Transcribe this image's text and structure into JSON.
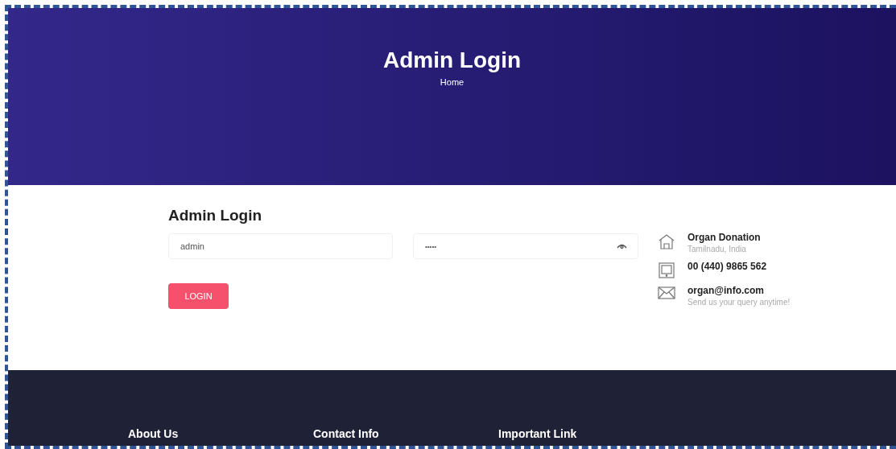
{
  "hero": {
    "title": "Admin Login",
    "breadcrumb": "Home"
  },
  "form": {
    "title": "Admin Login",
    "username": {
      "value": "admin"
    },
    "password": {
      "value": "•••••"
    },
    "button": "LOGIN"
  },
  "contact": [
    {
      "kind": "home",
      "title": "Organ Donation",
      "subtitle": "Tamilnadu, India"
    },
    {
      "kind": "phone",
      "title": "00 (440) 9865 562"
    },
    {
      "kind": "mail",
      "title": "organ@info.com",
      "subtitle": "Send us your query anytime!"
    }
  ],
  "footer": {
    "headings": [
      "About Us",
      "Contact Info",
      "Important Link"
    ]
  }
}
